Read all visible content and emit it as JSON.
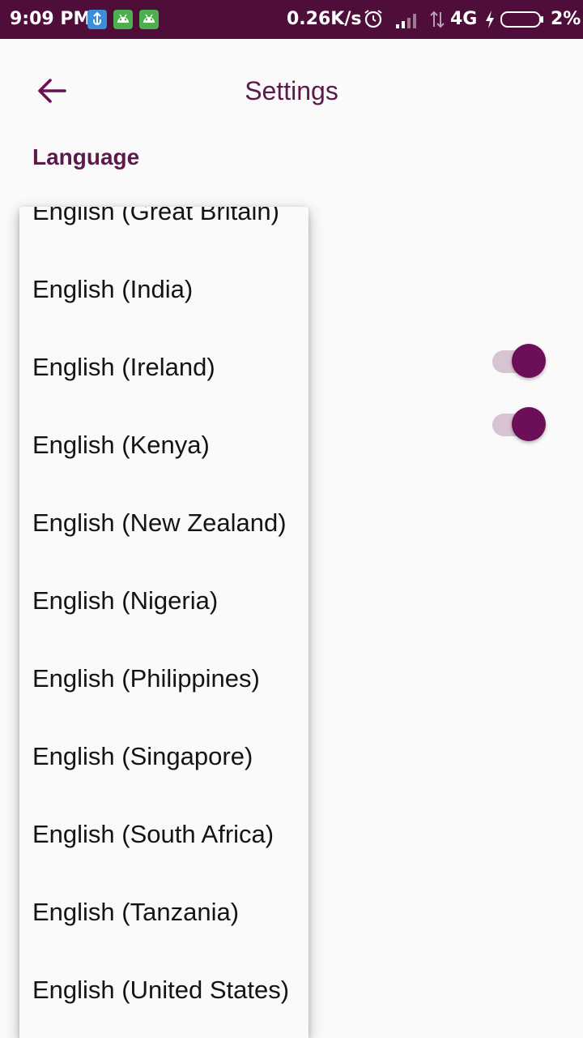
{
  "status_bar": {
    "time": "9:09 PM",
    "net_speed": "0.26K/s",
    "network": "4G",
    "battery": "2%",
    "icons": [
      "usb-icon",
      "android-debug-icon",
      "android-debug-icon",
      "alarm-icon",
      "signal-icon",
      "data-arrows-icon",
      "charging-icon",
      "battery-icon"
    ]
  },
  "header": {
    "title": "Settings",
    "back_icon": "arrow-left-icon"
  },
  "section": {
    "language_label": "Language"
  },
  "toggles": [
    {
      "checked": true
    },
    {
      "checked": true
    }
  ],
  "dropdown": {
    "options": [
      "English (Great Britain)",
      "English (India)",
      "English (Ireland)",
      "English (Kenya)",
      "English (New Zealand)",
      "English (Nigeria)",
      "English (Philippines)",
      "English (Singapore)",
      "English (South Africa)",
      "English (Tanzania)",
      "English (United States)"
    ]
  },
  "colors": {
    "status_bar": "#4f0e3a",
    "accent": "#5c1a4a",
    "toggle_thumb": "#6d0f58",
    "toggle_track": "#d8c3d2",
    "background": "#fafafa"
  }
}
